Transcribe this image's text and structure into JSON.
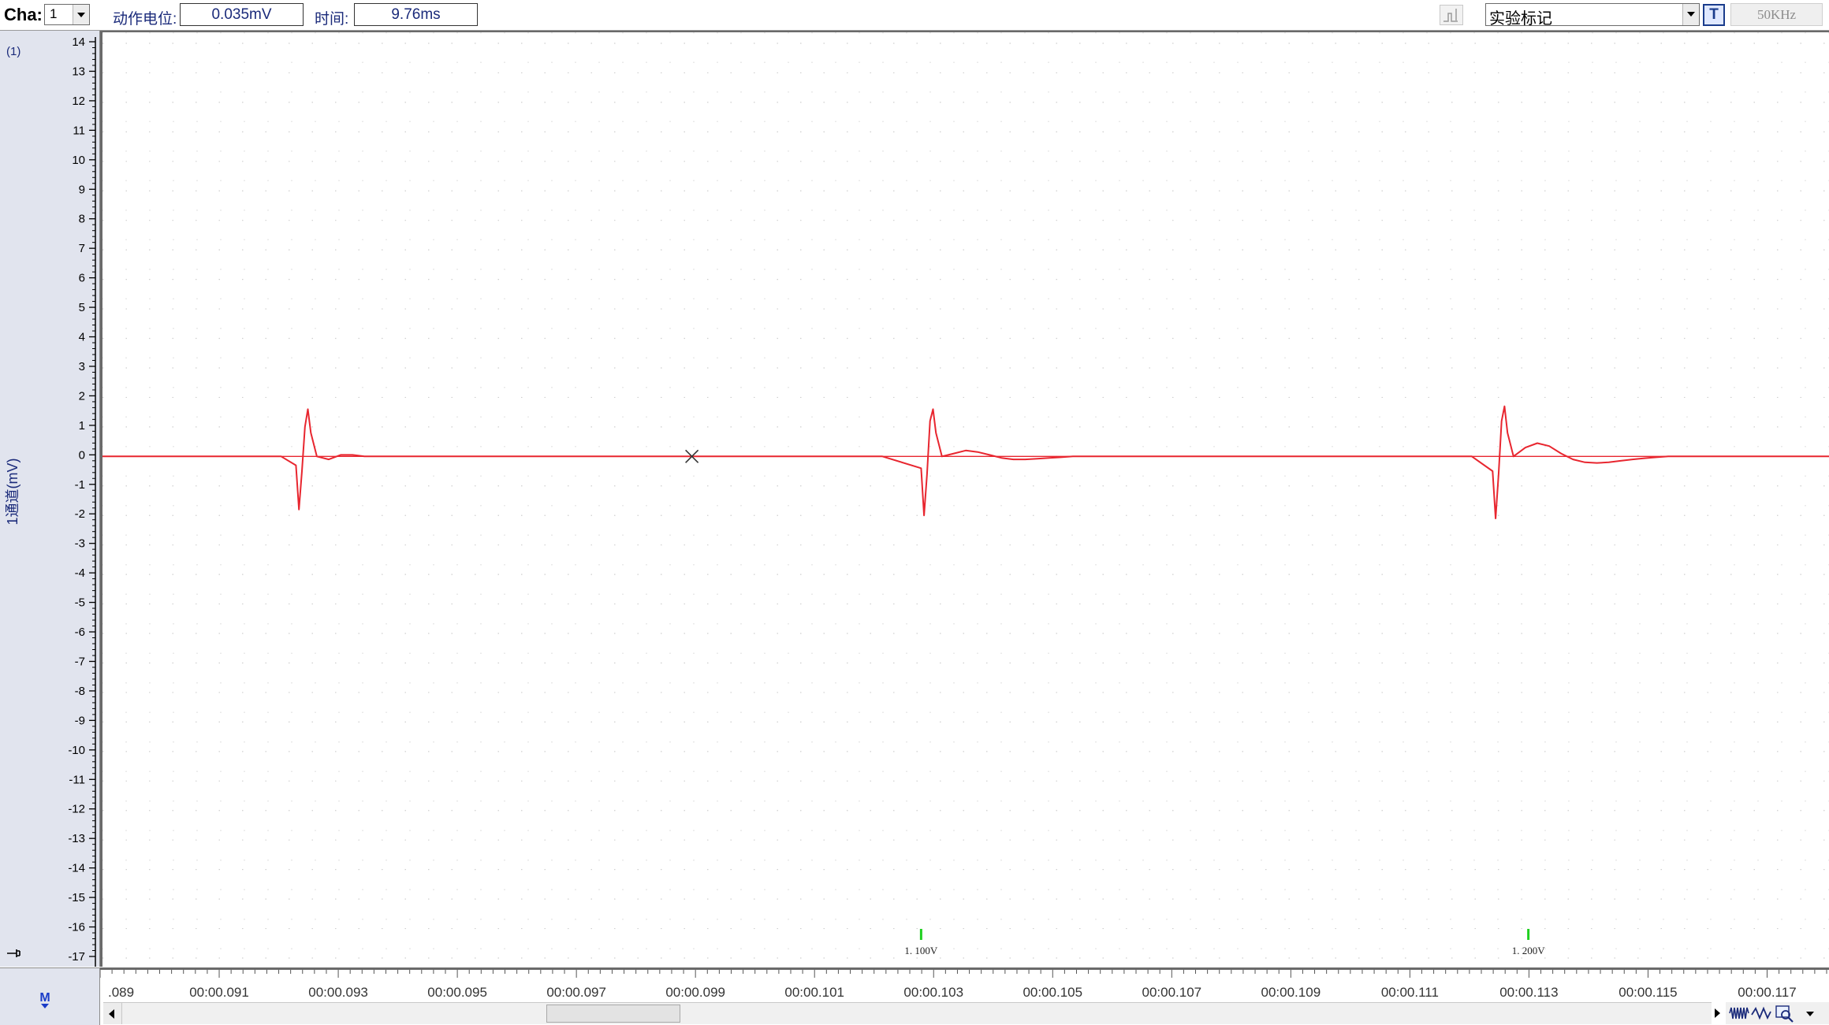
{
  "toolbar": {
    "channel_label": "Cha:",
    "channel_value": "1",
    "action_potential_label": "动作电位:",
    "action_potential_value": "0.035mV",
    "time_label": "时间:",
    "time_value": "9.76ms",
    "mark_select_value": "实验标记",
    "text_tool_label": "T",
    "sample_rate": "50KHz"
  },
  "y_axis": {
    "channel_index": "(1)",
    "channel_unit_label": "1通道(mV)",
    "ticks": [
      "14",
      "13",
      "12",
      "11",
      "10",
      "9",
      "8",
      "7",
      "6",
      "5",
      "4",
      "3",
      "2",
      "1",
      "0",
      "-1",
      "-2",
      "-3",
      "-4",
      "-5",
      "-6",
      "-7",
      "-8",
      "-9",
      "-10",
      "-11",
      "-12",
      "-13",
      "-14",
      "-15",
      "-16",
      "-17"
    ]
  },
  "bottom": {
    "m_marker": "M",
    "x_ticks": [
      ".089",
      "00:00.091",
      "00:00.093",
      "00:00.095",
      "00:00.097",
      "00:00.099",
      "00:00.101",
      "00:00.103",
      "00:00.105",
      "00:00.107",
      "00:00.109",
      "00:00.111",
      "00:00.113",
      "00:00.115",
      "00:00.117"
    ]
  },
  "chart_data": {
    "type": "line",
    "ylabel": "1通道(mV)",
    "ylim": [
      -17,
      14
    ],
    "xlim_s": [
      0.089,
      0.118
    ],
    "grid": true,
    "baseline_mV": 0,
    "series": [
      {
        "color": "#e8262f",
        "x": [
          0.0889,
          0.092,
          0.09225,
          0.0923,
          0.09235,
          0.0924,
          0.09245,
          0.0925,
          0.0926,
          0.0928,
          0.093,
          0.0932,
          0.0934,
          0.099,
          0.1021,
          0.10275,
          0.1028,
          0.10285,
          0.1029,
          0.10295,
          0.103,
          0.1031,
          0.1033,
          0.1035,
          0.1037,
          0.1039,
          0.1041,
          0.1043,
          0.1045,
          0.1047,
          0.1049,
          0.1051,
          0.1053,
          0.112,
          0.11235,
          0.1124,
          0.11245,
          0.1125,
          0.11255,
          0.1126,
          0.1127,
          0.1129,
          0.1131,
          0.1133,
          0.1135,
          0.1137,
          0.1139,
          0.1141,
          0.1143,
          0.1145,
          0.1147,
          0.1149,
          0.1151,
          0.1153,
          0.118
        ],
        "y": [
          0,
          0,
          -0.3,
          -1.8,
          -0.5,
          1.0,
          1.6,
          0.8,
          0,
          -0.1,
          0.05,
          0.05,
          0,
          0,
          0,
          -0.4,
          -2.0,
          -0.6,
          1.2,
          1.6,
          0.8,
          0,
          0.1,
          0.2,
          0.15,
          0.05,
          -0.05,
          -0.1,
          -0.1,
          -0.08,
          -0.05,
          -0.03,
          0,
          0,
          -0.5,
          -2.1,
          -0.6,
          1.2,
          1.7,
          0.8,
          0,
          0.3,
          0.45,
          0.35,
          0.1,
          -0.1,
          -0.2,
          -0.22,
          -0.2,
          -0.15,
          -0.1,
          -0.06,
          -0.03,
          0,
          0
        ]
      }
    ],
    "stimulus_markers": [
      {
        "x": 0.10275,
        "label": "1. 100V"
      },
      {
        "x": 0.11295,
        "label": "1. 200V"
      }
    ],
    "cursor": {
      "x": 0.0989,
      "y": 0
    }
  }
}
